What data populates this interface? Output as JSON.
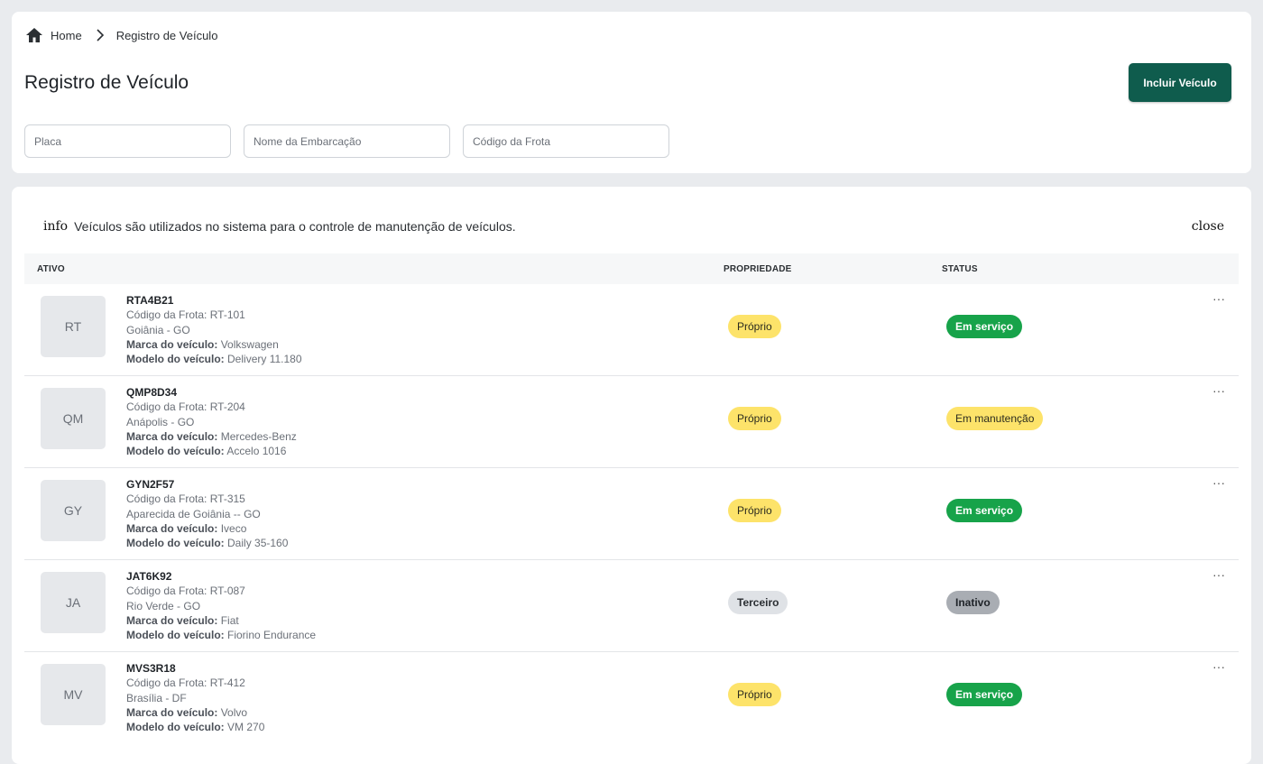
{
  "breadcrumb": {
    "home": "Home",
    "current": "Registro de Veículo"
  },
  "page": {
    "title": "Registro de Veículo",
    "add_button": "Incluir Veículo"
  },
  "filters": {
    "placa_placeholder": "Placa",
    "embarcacao_placeholder": "Nome da Embarcação",
    "frota_placeholder": "Código da Frota"
  },
  "info": {
    "icon": "info",
    "text": "Veículos são utilizados no sistema para o controle de manutenção de veículos.",
    "close": "close"
  },
  "table": {
    "headers": {
      "ativo": "ATIVO",
      "propriedade": "PROPRIEDADE",
      "status": "STATUS"
    },
    "labels": {
      "marca": "Marca do veículo:",
      "modelo": "Modelo do veículo:"
    },
    "menu": "···",
    "rows": [
      {
        "initials": "RT",
        "plate": "RTA4B21",
        "frota": "Código da Frota: RT-101",
        "cidade": "Goiânia - GO",
        "marca": "Volkswagen",
        "modelo": "Delivery 11.180",
        "propriedade": "Próprio",
        "status": "Em serviço"
      },
      {
        "initials": "QM",
        "plate": "QMP8D34",
        "frota": "Código da Frota: RT-204",
        "cidade": "Anápolis - GO",
        "marca": "Mercedes-Benz",
        "modelo": "Accelo 1016",
        "propriedade": "Próprio",
        "status": "Em manutenção"
      },
      {
        "initials": "GY",
        "plate": "GYN2F57",
        "frota": "Código da Frota: RT-315",
        "cidade": "Aparecida de Goiânia -- GO",
        "marca": "Iveco",
        "modelo": "Daily 35-160",
        "propriedade": "Próprio",
        "status": "Em serviço"
      },
      {
        "initials": "JA",
        "plate": "JAT6K92",
        "frota": "Código da Frota: RT-087",
        "cidade": "Rio Verde - GO",
        "marca": "Fiat",
        "modelo": "Fiorino Endurance",
        "propriedade": "Terceiro",
        "status": "Inativo"
      },
      {
        "initials": "MV",
        "plate": "MVS3R18",
        "frota": "Código da Frota: RT-412",
        "cidade": "Brasília - DF",
        "marca": "Volvo",
        "modelo": "VM 270",
        "propriedade": "Próprio",
        "status": "Em serviço"
      }
    ]
  },
  "colors": {
    "primary": "#0f5c4d",
    "green": "#17a34a",
    "yellow": "#fde36a",
    "gray": "#a9adb3"
  }
}
